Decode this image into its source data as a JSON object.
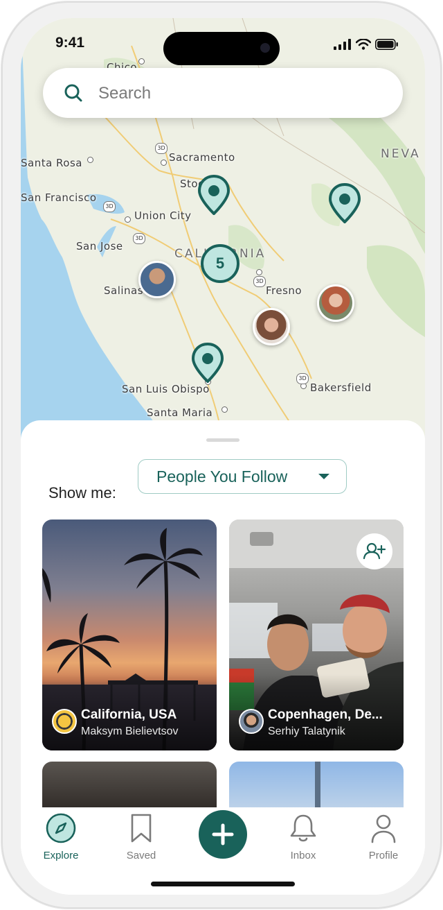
{
  "status_bar": {
    "time": "9:41"
  },
  "search": {
    "placeholder": "Search"
  },
  "map": {
    "labels": {
      "chico": "Chico",
      "santa_rosa": "Santa Rosa",
      "sacramento": "Sacramento",
      "stockton": "Stockton",
      "san_francisco": "San Francisco",
      "union_city": "Union City",
      "san_jose": "San Jose",
      "california": "CALIFORNIA",
      "salinas": "Salinas",
      "fresno": "Fresno",
      "nevada": "NEVA",
      "san_luis_obispo": "San Luis Obispo",
      "bakersfield": "Bakersfield",
      "santa_maria": "Santa Maria",
      "hwy": "3D"
    },
    "cluster_count": "5",
    "colors": {
      "pin": "#19625a",
      "pin_fill": "#bfe6e0",
      "water": "#a6d3ee",
      "land": "#eef0e4",
      "green": "#cfe3bd"
    }
  },
  "sheet": {
    "show_me_label": "Show me:",
    "filter": {
      "selected": "People You Follow"
    }
  },
  "cards": [
    {
      "title": "California, USA",
      "user": "Maksym Bielievtsov"
    },
    {
      "title": "Copenhagen, De...",
      "user": "Serhiy Talatynik"
    }
  ],
  "tabs": {
    "explore": "Explore",
    "saved": "Saved",
    "inbox": "Inbox",
    "profile": "Profile"
  },
  "icons": [
    "search-icon",
    "map-pin-icon",
    "add-person-icon",
    "compass-icon",
    "bookmark-icon",
    "plus-icon",
    "bell-icon",
    "person-icon",
    "signal-icon",
    "wifi-icon",
    "battery-icon",
    "chevron-down-icon"
  ]
}
